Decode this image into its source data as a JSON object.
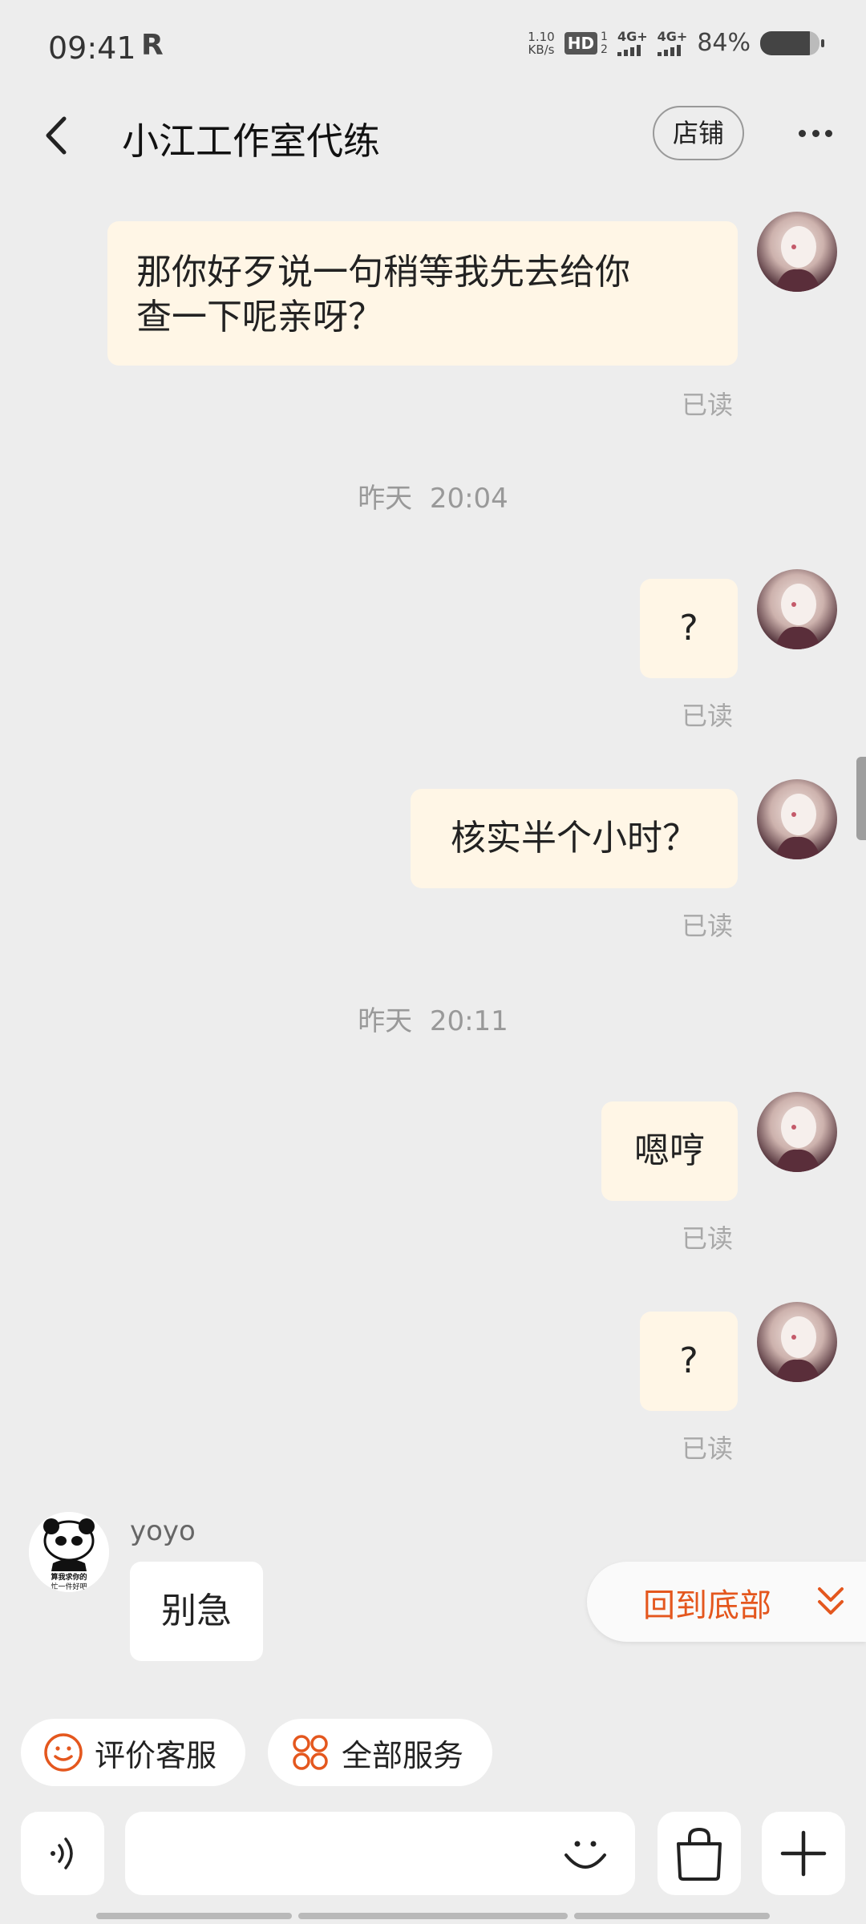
{
  "status_bar": {
    "time": "09:41",
    "r_badge": "R",
    "speed_value": "1.10",
    "speed_unit": "KB/s",
    "hd": "HD",
    "hd_sub": "1",
    "hd_sub2": "2",
    "net1": "4G+",
    "net2": "4G+",
    "battery": "84%",
    "battery_level": 0.84
  },
  "header": {
    "title": "小江工作室代练",
    "shop_label": "店铺"
  },
  "messages": {
    "m1": {
      "line1": "那你好歹说一句稍等我先去给你",
      "line2": "查一下呢亲呀？",
      "status": "已读"
    },
    "ts1": {
      "day": "昨天",
      "time": "20:04"
    },
    "m2": {
      "text": "?",
      "status": "已读"
    },
    "m3": {
      "text": "核实半个小时？",
      "status": "已读"
    },
    "ts2": {
      "day": "昨天",
      "time": "20:11"
    },
    "m4": {
      "text": "嗯哼",
      "status": "已读"
    },
    "m5": {
      "text": "?",
      "status": "已读"
    },
    "m6": {
      "sender": "yoyo",
      "text": "别急",
      "avatar_caption1": "算我求你的",
      "avatar_caption2": "忙一件好吧"
    }
  },
  "back_to_bottom": "回到底部",
  "chips": {
    "rate_service": "评价客服",
    "all_services": "全部服务"
  },
  "colors": {
    "accent": "#e4571e",
    "bubble_self": "#fff6e6",
    "background": "#ededed"
  }
}
